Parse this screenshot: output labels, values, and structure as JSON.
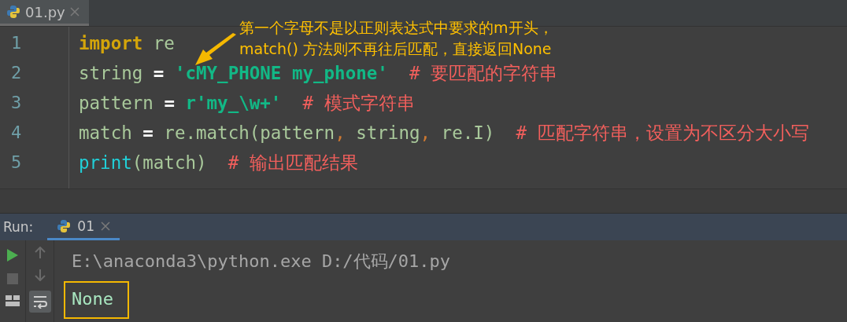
{
  "editor_tabs": [
    {
      "label": "01.py",
      "selected": true
    }
  ],
  "code_lines": [
    {
      "number": "1",
      "tokens": [
        {
          "kind": "keyword",
          "text": "import"
        },
        {
          "kind": "plain",
          "text": " re"
        }
      ]
    },
    {
      "number": "2",
      "tokens": [
        {
          "kind": "plain",
          "text": "string "
        },
        {
          "kind": "op",
          "text": "= "
        },
        {
          "kind": "string",
          "text": "'cMY_PHONE my_phone'"
        },
        {
          "kind": "comment",
          "text": "  # 要匹配的字符串"
        }
      ]
    },
    {
      "number": "3",
      "tokens": [
        {
          "kind": "plain",
          "text": "pattern "
        },
        {
          "kind": "op",
          "text": "= "
        },
        {
          "kind": "string",
          "text": "r'my_\\w+'"
        },
        {
          "kind": "comment",
          "text": "  # 模式字符串"
        }
      ]
    },
    {
      "number": "4",
      "tokens": [
        {
          "kind": "plain",
          "text": "match "
        },
        {
          "kind": "op",
          "text": "="
        },
        {
          "kind": "plain",
          "text": " re.match(pattern"
        },
        {
          "kind": "comma",
          "text": ","
        },
        {
          "kind": "plain",
          "text": " string"
        },
        {
          "kind": "comma",
          "text": ","
        },
        {
          "kind": "plain",
          "text": " re.I)"
        },
        {
          "kind": "comment",
          "text": "  # 匹配字符串，设置为不区分大小写"
        }
      ]
    },
    {
      "number": "5",
      "tokens": [
        {
          "kind": "builtin",
          "text": "print"
        },
        {
          "kind": "plain",
          "text": "(match)"
        },
        {
          "kind": "comment",
          "text": "  # 输出匹配结果"
        }
      ]
    }
  ],
  "annotation": {
    "lines": [
      "第一个字母不是以正则表达式中要求的m开头，",
      "match() 方法则不再往后匹配，直接返回None"
    ]
  },
  "run_panel": {
    "label": "Run:",
    "tabs": [
      {
        "label": "01",
        "selected": true
      }
    ],
    "console": [
      {
        "kind": "command",
        "text": "E:\\anaconda3\\python.exe D:/代码/01.py",
        "highlighted": false
      },
      {
        "kind": "output",
        "text": "None",
        "highlighted": true
      }
    ]
  }
}
